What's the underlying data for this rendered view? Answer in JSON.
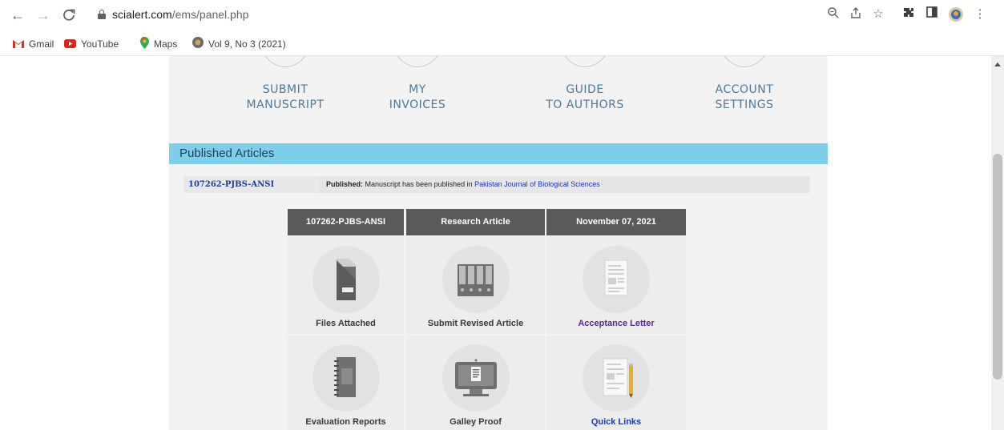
{
  "browser": {
    "url_domain": "scialert.com",
    "url_path": "/ems/panel.php",
    "bookmarks": [
      {
        "label": "Gmail",
        "icon": "gmail-icon"
      },
      {
        "label": "YouTube",
        "icon": "youtube-icon"
      },
      {
        "label": "Maps",
        "icon": "maps-icon"
      },
      {
        "label": "Vol 9, No 3 (2021)",
        "icon": "site-icon"
      }
    ]
  },
  "menu": [
    {
      "line1": "SUBMIT",
      "line2": "MANUSCRIPT"
    },
    {
      "line1": "MY",
      "line2": "INVOICES"
    },
    {
      "line1": "GUIDE",
      "line2": "TO AUTHORS"
    },
    {
      "line1": "ACCOUNT",
      "line2": "SETTINGS"
    }
  ],
  "section": {
    "title": "Published Articles"
  },
  "article": {
    "id": "107262-PJBS-ANSI",
    "status_label": "Published:",
    "status_text": "Manuscript has been published in",
    "journal": "Pakistan Journal of Biological Sciences"
  },
  "grid": {
    "headers": [
      "107262-PJBS-ANSI",
      "Research Article",
      "November 07, 2021"
    ],
    "cells": [
      {
        "label": "Files Attached",
        "icon": "folder-icon"
      },
      {
        "label": "Submit Revised Article",
        "icon": "binders-icon"
      },
      {
        "label": "Acceptance Letter",
        "icon": "document-icon"
      },
      {
        "label": "Evaluation Reports",
        "icon": "notebook-icon"
      },
      {
        "label": "Galley Proof",
        "icon": "monitor-icon"
      },
      {
        "label": "Quick Links",
        "icon": "notepad-pencil-icon"
      }
    ]
  },
  "colors": {
    "header_bar": "#7ecfea",
    "grid_header": "#5a5a5a",
    "menu_text": "#4d7a9a",
    "link_blue": "#1a33cc",
    "link_purple": "#5a2a8a"
  }
}
